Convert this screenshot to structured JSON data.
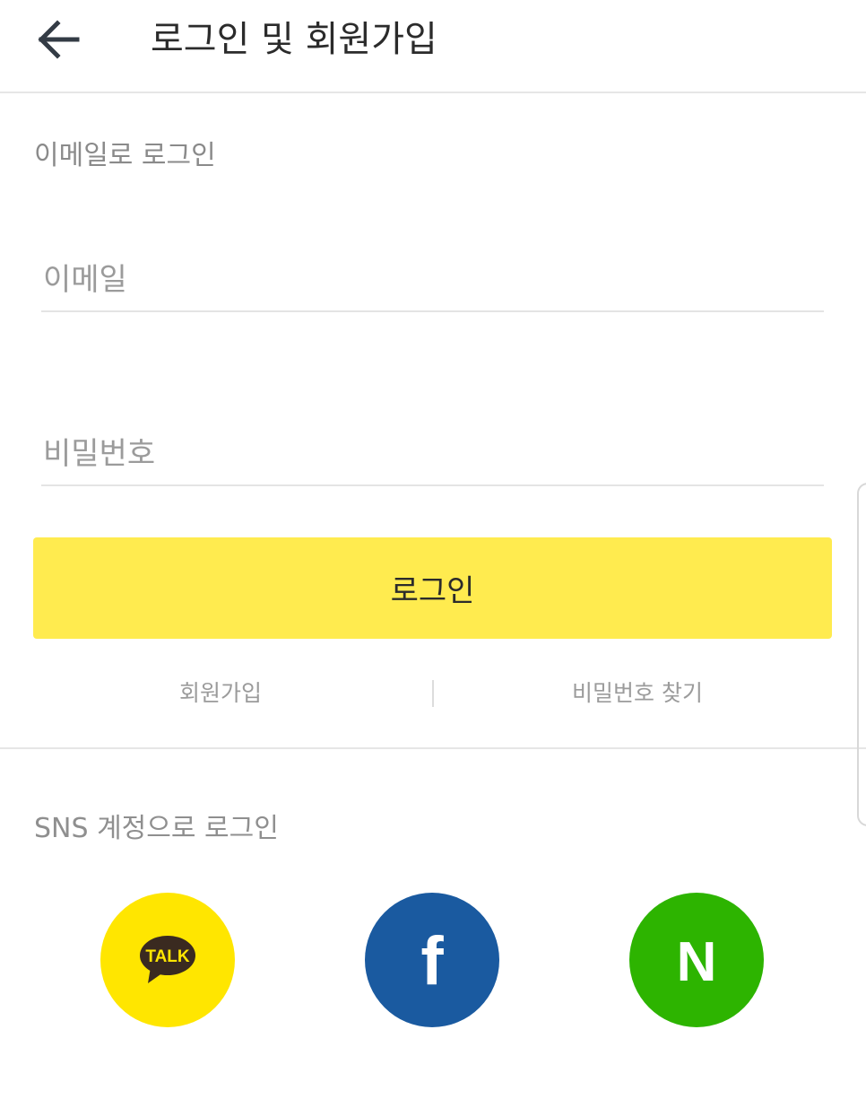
{
  "header": {
    "back_icon": "arrow-left-icon",
    "title": "로그인 및 회원가입"
  },
  "email_login": {
    "section_label": "이메일로 로그인",
    "email_placeholder": "이메일",
    "email_value": "",
    "password_placeholder": "비밀번호",
    "password_value": "",
    "login_button_label": "로그인"
  },
  "links": {
    "signup_label": "회원가입",
    "find_password_label": "비밀번호 찾기"
  },
  "sns": {
    "section_label": "SNS 계정으로 로그인",
    "providers": [
      {
        "name": "kakao",
        "icon": "kakaotalk-icon",
        "icon_text": "TALK",
        "color": "#ffe600"
      },
      {
        "name": "facebook",
        "icon": "facebook-icon",
        "icon_text": "f",
        "color": "#1a5aa0"
      },
      {
        "name": "naver",
        "icon": "naver-icon",
        "icon_text": "N",
        "color": "#2db400"
      }
    ]
  },
  "colors": {
    "login_button": "#ffeb4f",
    "divider": "#e6e6e6",
    "muted_text": "#9b9b9b"
  }
}
